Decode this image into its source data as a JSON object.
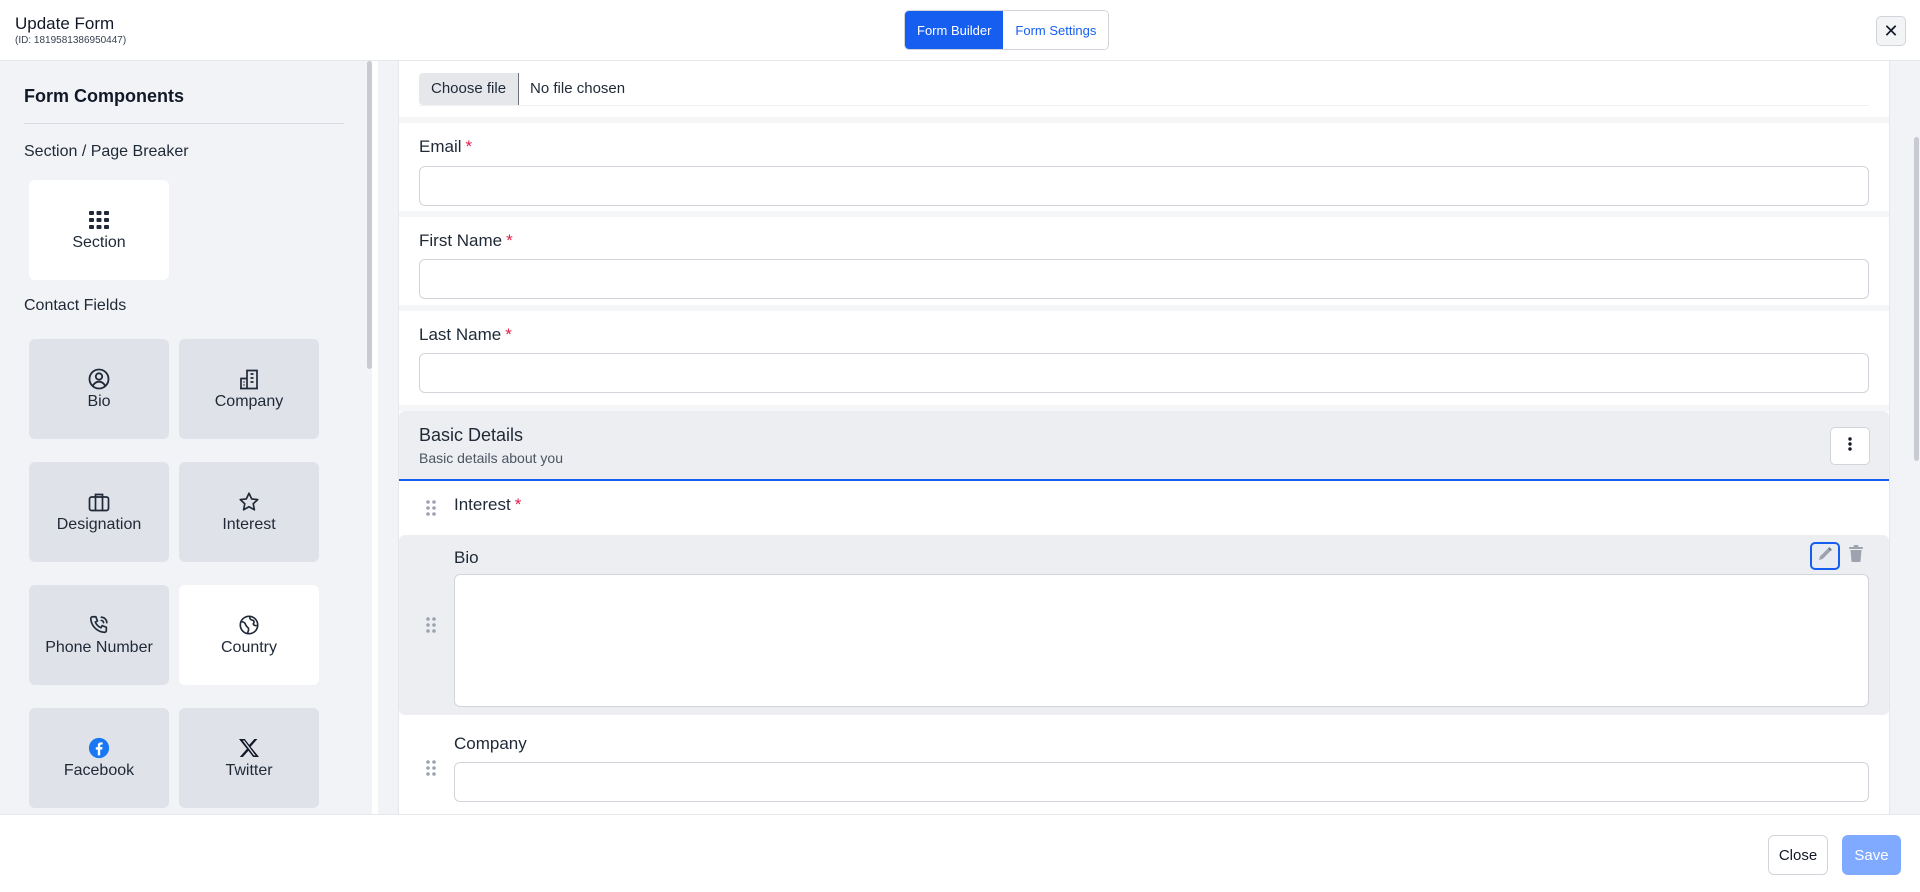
{
  "header": {
    "title": "Update Form",
    "form_id": "(ID: 1819581386950447)",
    "tabs": [
      {
        "label": "Form Builder",
        "active": true
      },
      {
        "label": "Form Settings",
        "active": false
      }
    ],
    "close_symbol": "✕"
  },
  "sidebar": {
    "heading": "Form Components",
    "groups": [
      {
        "label": "Section / Page Breaker",
        "items": [
          {
            "label": "Section",
            "icon": "grid-icon"
          }
        ]
      },
      {
        "label": "Contact Fields",
        "items": [
          {
            "label": "Bio",
            "icon": "user-circle-icon"
          },
          {
            "label": "Company",
            "icon": "building-icon"
          },
          {
            "label": "Designation",
            "icon": "briefcase-icon"
          },
          {
            "label": "Interest",
            "icon": "star-icon"
          },
          {
            "label": "Phone Number",
            "icon": "phone-icon"
          },
          {
            "label": "Country",
            "icon": "globe-icon"
          },
          {
            "label": "Facebook",
            "icon": "facebook-icon"
          },
          {
            "label": "Twitter",
            "icon": "x-twitter-icon"
          }
        ]
      }
    ]
  },
  "main": {
    "file_field": {
      "button_label": "Choose file",
      "status": "No file chosen"
    },
    "fields": [
      {
        "label": "Email",
        "required": "*"
      },
      {
        "label": "First Name",
        "required": "*"
      },
      {
        "label": "Last Name",
        "required": "*"
      }
    ],
    "section": {
      "title": "Basic Details",
      "description": "Basic details about you",
      "rows": [
        {
          "label": "Interest",
          "required": "*"
        },
        {
          "label": "Bio"
        },
        {
          "label": "Company"
        }
      ]
    }
  },
  "footer": {
    "close_label": "Close",
    "save_label": "Save"
  },
  "colors": {
    "primary": "#155eef",
    "required": "#e11d48",
    "save_disabled": "#80aaff"
  }
}
